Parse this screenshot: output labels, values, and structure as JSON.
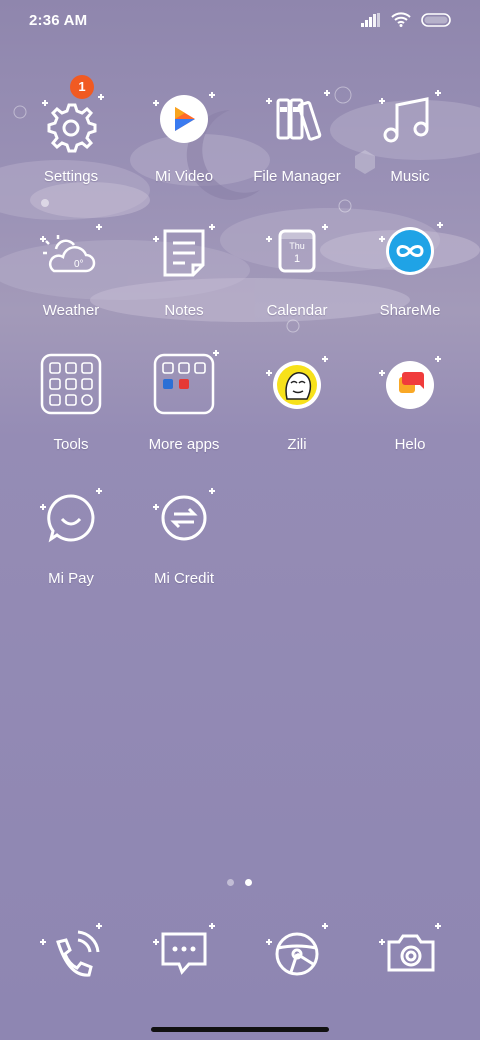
{
  "status_bar": {
    "time": "2:36 AM"
  },
  "apps": [
    {
      "label": "Settings",
      "badge": "1"
    },
    {
      "label": "Mi Video"
    },
    {
      "label": "File Manager"
    },
    {
      "label": "Music"
    },
    {
      "label": "Weather",
      "temp": "0°"
    },
    {
      "label": "Notes"
    },
    {
      "label": "Calendar",
      "day": "Thu",
      "date": "1"
    },
    {
      "label": "ShareMe"
    },
    {
      "label": "Tools"
    },
    {
      "label": "More apps"
    },
    {
      "label": "Zili"
    },
    {
      "label": "Helo"
    },
    {
      "label": "Mi Pay"
    },
    {
      "label": "Mi Credit"
    }
  ],
  "page_indicator": {
    "pages": 2,
    "current": 2
  },
  "dock": [
    {
      "name": "phone-icon"
    },
    {
      "name": "messages-icon"
    },
    {
      "name": "browser-icon"
    },
    {
      "name": "camera-icon"
    }
  ]
}
